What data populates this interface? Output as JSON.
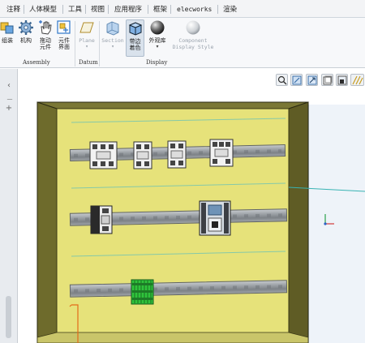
{
  "ribbon_tabs": [
    {
      "label": "注释"
    },
    {
      "label": "人体模型"
    },
    {
      "label": "工具"
    },
    {
      "label": "视图"
    },
    {
      "label": "应用程序"
    },
    {
      "label": "框架"
    },
    {
      "label": "elecworks"
    },
    {
      "label": "渲染"
    }
  ],
  "ribbon": {
    "assembly_buttons": [
      {
        "label": "组装",
        "icon": "assemble-icon"
      },
      {
        "label": "机构",
        "icon": "gear-icon"
      },
      {
        "label": "拖动\n元件",
        "icon": "drag-hand-icon"
      },
      {
        "label": "元件\n界面",
        "icon": "component-interface-icon"
      }
    ],
    "datum_buttons": [
      {
        "label": "Plane",
        "icon": "plane-icon"
      }
    ],
    "display_buttons": [
      {
        "label": "Section",
        "icon": "section-icon"
      },
      {
        "label": "带边\n着色",
        "icon": "shaded-edges-icon"
      },
      {
        "label": "外观库",
        "icon": "appearance-sphere-icon"
      },
      {
        "label": "Component\nDisplay Style",
        "icon": "component-display-style-icon"
      }
    ],
    "groups": {
      "assembly": "Assembly",
      "datum": "Datum",
      "display": "Display"
    }
  },
  "view_toolbar": [
    {
      "icon": "zoom-in-icon"
    },
    {
      "icon": "refit-icon"
    },
    {
      "icon": "repaint-icon"
    },
    {
      "icon": "saved-orientations-icon"
    },
    {
      "icon": "display-style-icon"
    },
    {
      "icon": "datum-display-icon"
    }
  ],
  "colors": {
    "panel_face": "#e6e27a",
    "cabinet_side": "#6e6b2c",
    "cabinet_top": "#7a7735",
    "guide_line": "#86c9a8",
    "component_green": "#2fc33c"
  }
}
